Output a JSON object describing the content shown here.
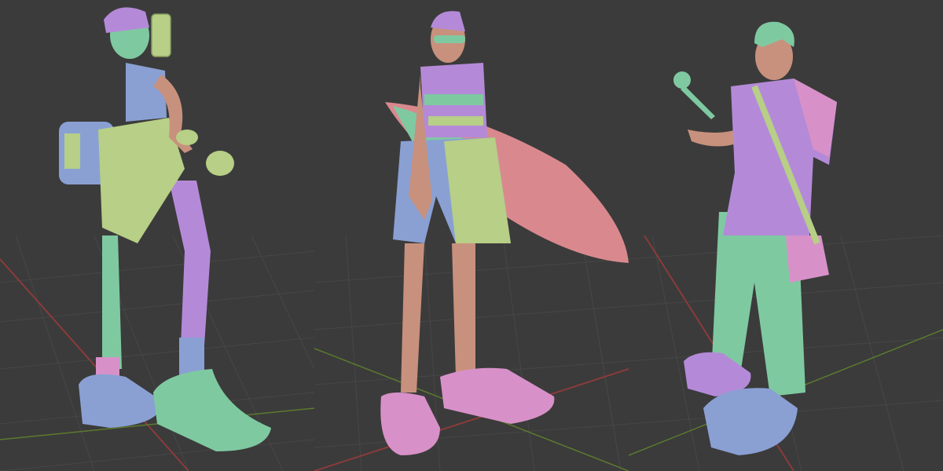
{
  "viewports": [
    {
      "subject": "character-with-phone-and-dumbbell"
    },
    {
      "subject": "character-with-surfboard"
    },
    {
      "subject": "character-with-microphone"
    }
  ],
  "colors": {
    "background": "#3b3b3b",
    "grid": "#4a4a4a",
    "axis_x": "#8b3b3b",
    "axis_y": "#5c7a2e",
    "skin": "#c8917d",
    "mint": "#7fc9a1",
    "lilac": "#b48ad8",
    "pink": "#d891c8",
    "lime": "#b7cf86",
    "blue": "#8aa0d3",
    "salmon": "#d9898e"
  }
}
